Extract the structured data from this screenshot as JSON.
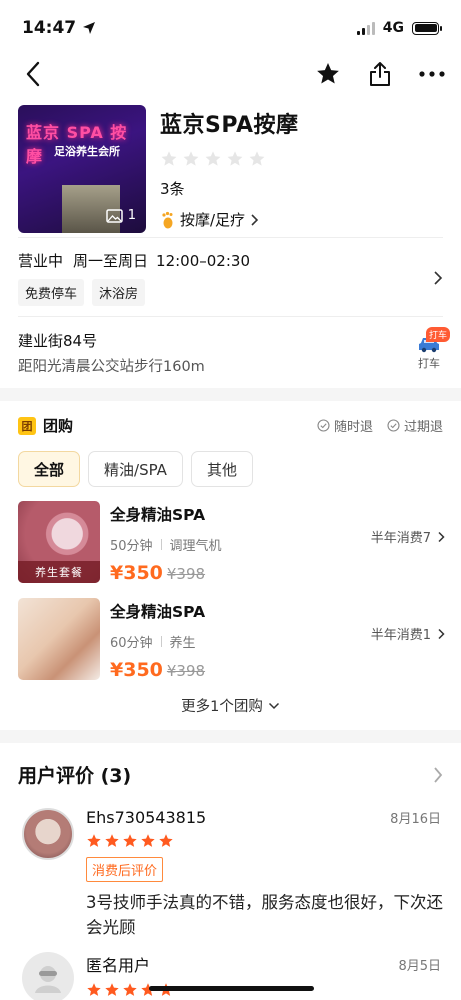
{
  "status": {
    "time": "14:47",
    "network": "4G"
  },
  "shop": {
    "name": "蓝京SPA按摩",
    "image_sign": "蓝京 SPA 按摩",
    "image_sub": "足浴养生会所",
    "photo_count": "1",
    "rating_stars": 0,
    "review_count": "3条",
    "category": "按摩/足疗"
  },
  "hours": {
    "status": "营业中",
    "days": "周一至周日",
    "time": "12:00–02:30"
  },
  "facilities": [
    "免费停车",
    "沐浴房"
  ],
  "address": {
    "street": "建业街84号",
    "distance": "距阳光清晨公交站步行160m",
    "taxi_label": "打车",
    "taxi_badge": "打车"
  },
  "group": {
    "badge": "团",
    "title": "团购",
    "guarantees": [
      "随时退",
      "过期退"
    ],
    "tabs": [
      "全部",
      "精油/SPA",
      "其他"
    ],
    "deals": [
      {
        "title": "全身精油SPA",
        "duration": "50分钟",
        "feature": "调理气机",
        "price": "¥350",
        "original": "¥398",
        "sales": "半年消费7",
        "ribbon": "养生套餐"
      },
      {
        "title": "全身精油SPA",
        "duration": "60分钟",
        "feature": "养生",
        "price": "¥350",
        "original": "¥398",
        "sales": "半年消费1",
        "ribbon": ""
      }
    ],
    "more": "更多1个团购"
  },
  "reviews": {
    "title": "用户评价 (3)",
    "items": [
      {
        "name": "Ehs730543815",
        "date": "8月16日",
        "stars": 5,
        "tag": "消费后评价",
        "text": "3号技师手法真的不错，服务态度也很好，下次还会光顾"
      },
      {
        "name": "匿名用户",
        "date": "8月5日",
        "stars": 5
      }
    ]
  },
  "colors": {
    "accent": "#ff6a1f",
    "star": "#ff5a1f",
    "group_badge": "#ffc414"
  }
}
